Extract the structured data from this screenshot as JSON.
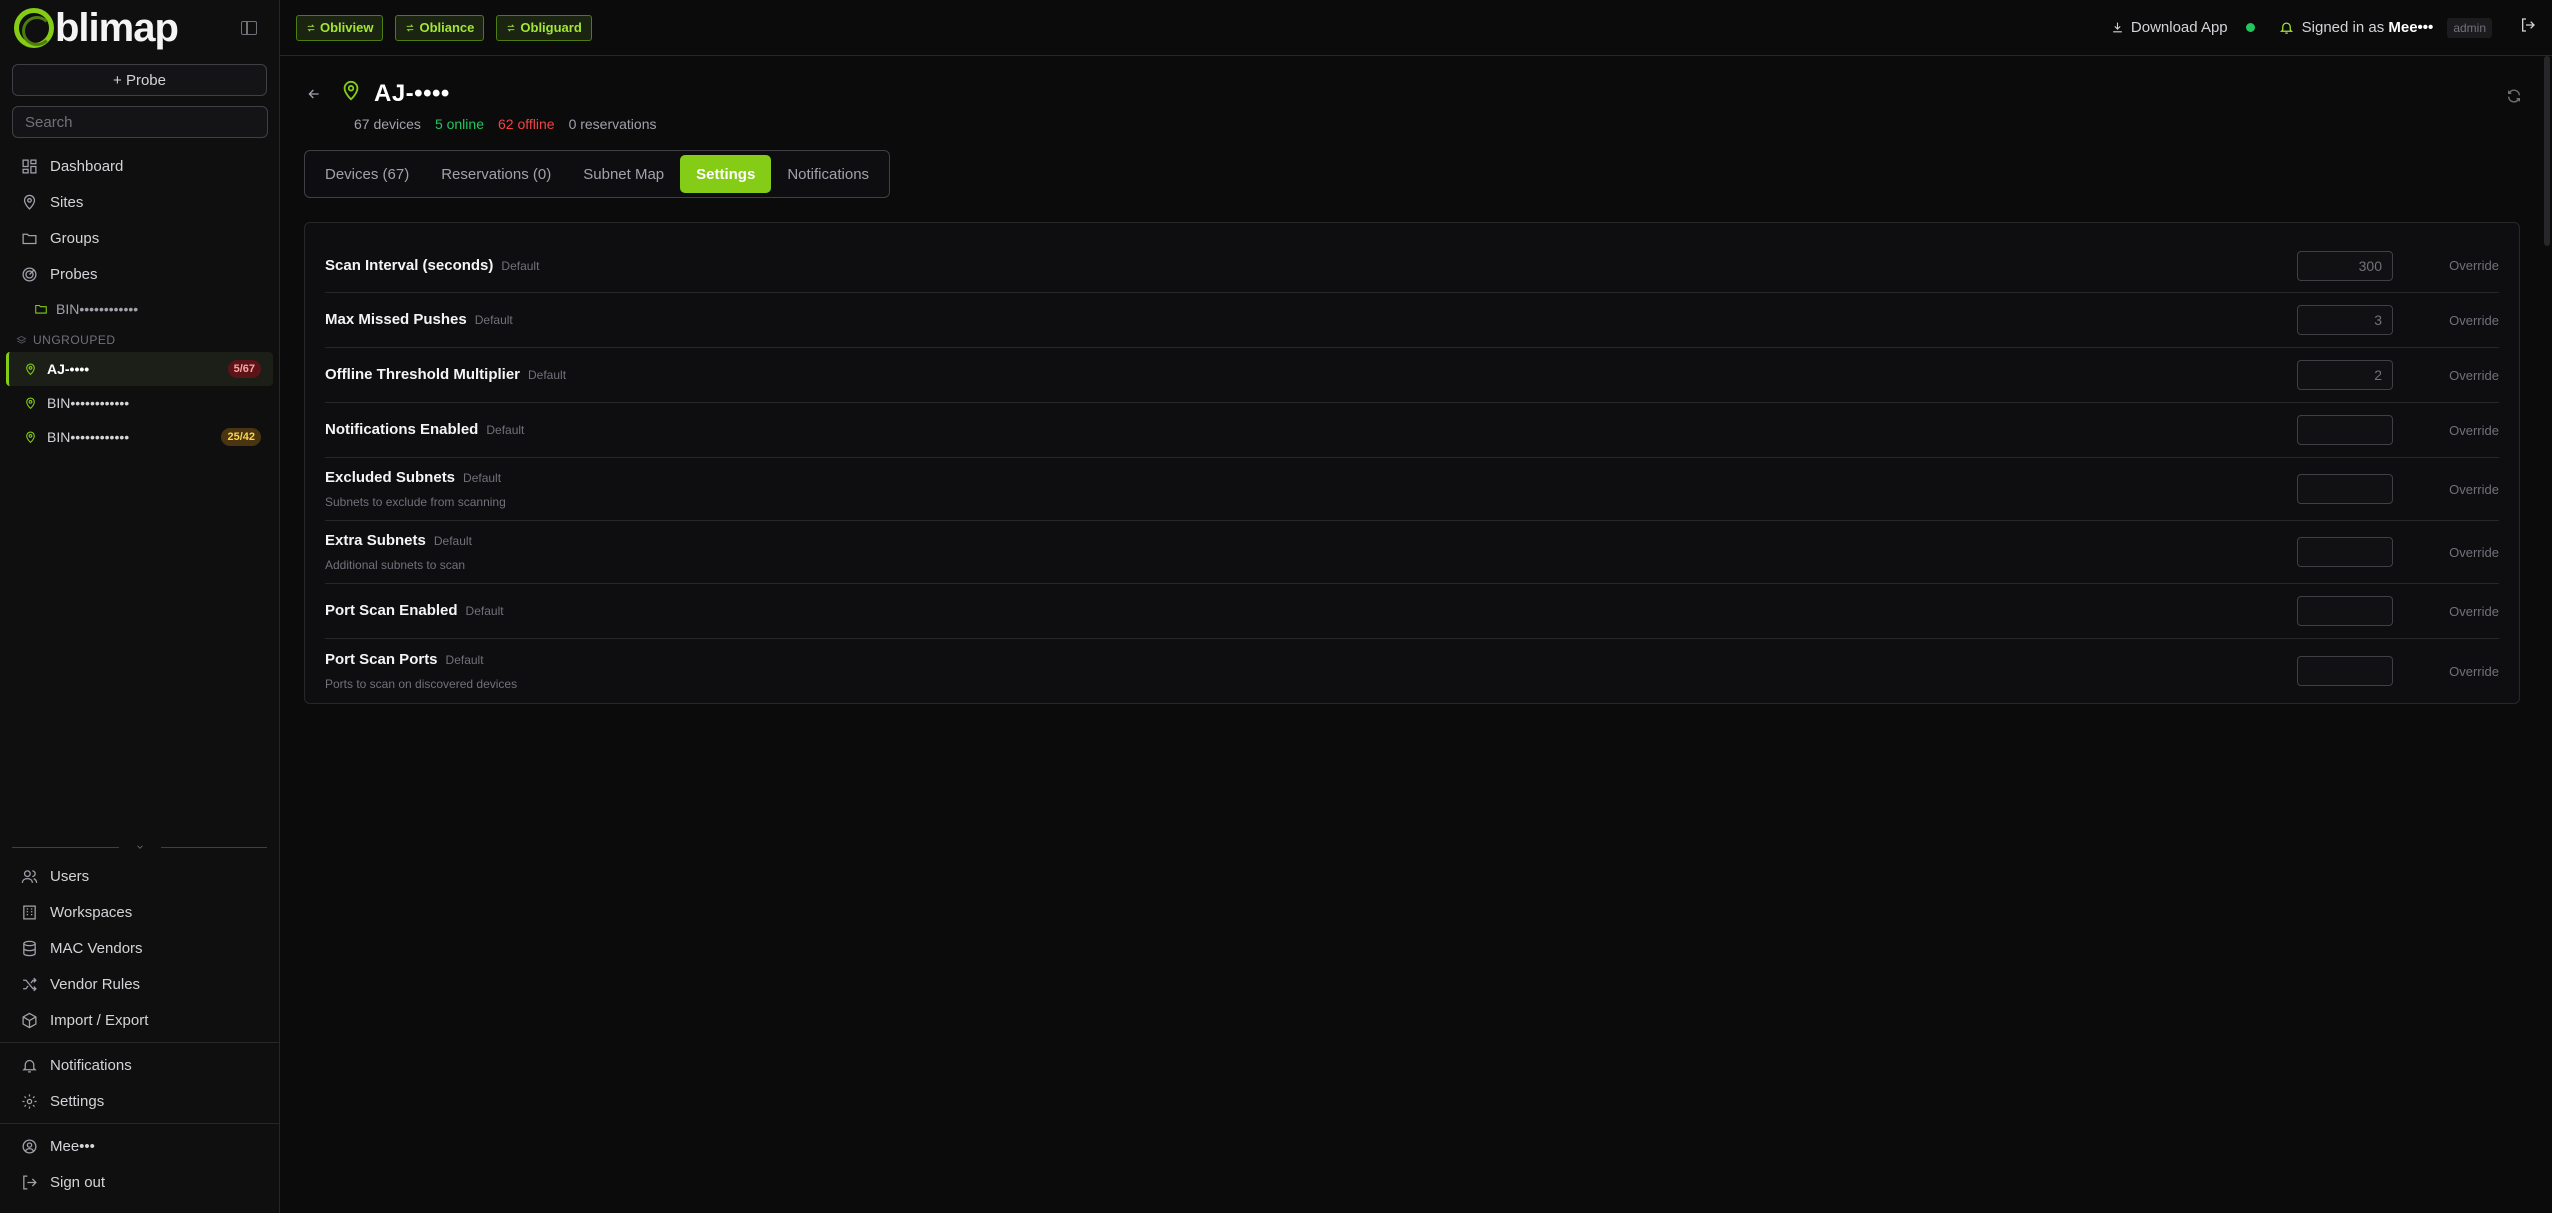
{
  "sidebar": {
    "logo_text": "blimap",
    "probe_button": "+ Probe",
    "search_placeholder": "Search",
    "nav": [
      {
        "label": "Dashboard",
        "icon": "dashboard-icon"
      },
      {
        "label": "Sites",
        "icon": "map-pin-icon"
      },
      {
        "label": "Groups",
        "icon": "folder-icon"
      },
      {
        "label": "Probes",
        "icon": "radar-icon"
      }
    ],
    "probe_folder": "BIN••••••••••••",
    "ungrouped_label": "UNGROUPED",
    "sites": [
      {
        "name": "AJ-••••",
        "badge": "5/67",
        "badge_color": "#5b1417"
      },
      {
        "name": "BIN••••••••••••",
        "badge": ""
      },
      {
        "name": "BIN••••••••••••",
        "badge": "25/42",
        "badge_color": "#4a3510"
      }
    ],
    "bottom_nav": [
      {
        "label": "Users",
        "icon": "users-icon"
      },
      {
        "label": "Workspaces",
        "icon": "building-icon"
      },
      {
        "label": "MAC Vendors",
        "icon": "database-icon"
      },
      {
        "label": "Vendor Rules",
        "icon": "shuffle-icon"
      },
      {
        "label": "Import / Export",
        "icon": "package-icon"
      }
    ],
    "footer_nav": [
      {
        "label": "Notifications",
        "icon": "bell-icon"
      },
      {
        "label": "Settings",
        "icon": "gear-icon"
      }
    ],
    "user_nav": [
      {
        "label": "Mee•••",
        "icon": "user-circle-icon"
      },
      {
        "label": "Sign out",
        "icon": "logout-icon"
      }
    ]
  },
  "topbar": {
    "apps": [
      "Obliview",
      "Obliance",
      "Obliguard"
    ],
    "download": "Download App",
    "signed_prefix": "Signed in as",
    "user": "Mee•••",
    "role": "admin",
    "status_color": "#22c55e"
  },
  "page": {
    "title": "AJ-••••",
    "devices": "67 devices",
    "online": "5 online",
    "offline": "62 offline",
    "reservations": "0 reservations",
    "tabs": [
      "Devices (67)",
      "Reservations (0)",
      "Subnet Map",
      "Settings",
      "Notifications"
    ],
    "active_tab": "Settings"
  },
  "settings": [
    {
      "name": "Scan Interval (seconds)",
      "default_label": "Default",
      "desc": "",
      "value": "300",
      "override": "Override"
    },
    {
      "name": "Max Missed Pushes",
      "default_label": "Default",
      "desc": "",
      "value": "3",
      "override": "Override"
    },
    {
      "name": "Offline Threshold Multiplier",
      "default_label": "Default",
      "desc": "",
      "value": "2",
      "override": "Override"
    },
    {
      "name": "Notifications Enabled",
      "default_label": "Default",
      "desc": "",
      "value": "",
      "override": "Override"
    },
    {
      "name": "Excluded Subnets",
      "default_label": "Default",
      "desc": "Subnets to exclude from scanning",
      "value": "",
      "override": "Override"
    },
    {
      "name": "Extra Subnets",
      "default_label": "Default",
      "desc": "Additional subnets to scan",
      "value": "",
      "override": "Override"
    },
    {
      "name": "Port Scan Enabled",
      "default_label": "Default",
      "desc": "",
      "value": "",
      "override": "Override"
    },
    {
      "name": "Port Scan Ports",
      "default_label": "Default",
      "desc": "Ports to scan on discovered devices",
      "value": "",
      "override": "Override"
    }
  ],
  "colors": {
    "accent": "#84cc16",
    "online": "#22c55e",
    "offline": "#ef4444"
  }
}
